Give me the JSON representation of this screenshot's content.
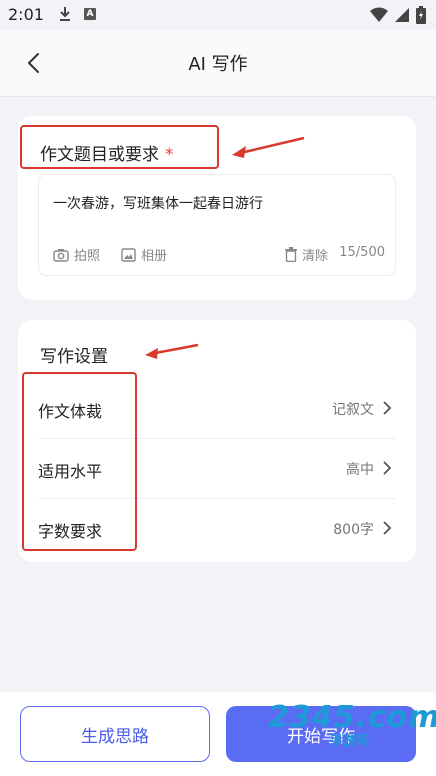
{
  "status_bar": {
    "time": "2:01",
    "a_badge": "A"
  },
  "nav": {
    "title": "AI 写作"
  },
  "topic": {
    "label": "作文题目或要求",
    "required_mark": "*",
    "value": "一次春游，写班集体一起春日游行",
    "camera_label": "拍照",
    "album_label": "相册",
    "clear_label": "清除",
    "counter": "15/500"
  },
  "settings": {
    "title": "写作设置",
    "rows": [
      {
        "label": "作文体裁",
        "value": "记叙文"
      },
      {
        "label": "适用水平",
        "value": "高中"
      },
      {
        "label": "字数要求",
        "value": "800字"
      }
    ]
  },
  "actions": {
    "outline_label": "生成思路",
    "start_label": "开始写作"
  },
  "watermark": {
    "logo": "2345.com",
    "sub": "手游网"
  },
  "colors": {
    "accent": "#5a6cf3",
    "annotation": "#d9392c",
    "required": "#e5433a"
  }
}
